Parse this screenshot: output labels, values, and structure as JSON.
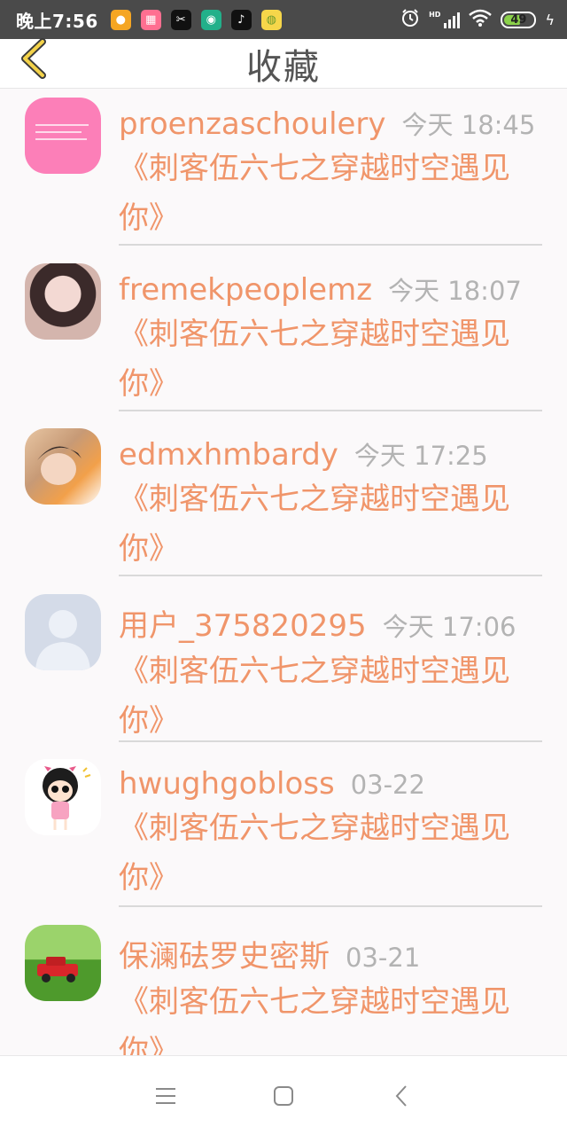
{
  "status_bar": {
    "time": "晚上7:56",
    "battery": "49",
    "apps": [
      {
        "icon": "weibo-icon",
        "color": "#f5a623"
      },
      {
        "icon": "game-center-icon",
        "color": "#ff6f91"
      },
      {
        "icon": "capcut-icon",
        "color": "#111111"
      },
      {
        "icon": "podcast-icon",
        "color": "#22b08a"
      },
      {
        "icon": "tiktok-icon",
        "color": "#111111"
      },
      {
        "icon": "chat-bubble-icon",
        "color": "#f6d64a"
      }
    ]
  },
  "header": {
    "title": "收藏",
    "back_icon": "chevron-left-icon"
  },
  "items": [
    {
      "username": "proenzaschoulery",
      "time": "今天 18:45",
      "book": "《刺客伍六七之穿越时空遇见你》",
      "avatar": "pink-note-avatar"
    },
    {
      "username": "fremekpeoplemz",
      "time": "今天 18:07",
      "book": "《刺客伍六七之穿越时空遇见你》",
      "avatar": "girl-photo-avatar"
    },
    {
      "username": "edmxhmbardy",
      "time": "今天 17:25",
      "book": "《刺客伍六七之穿越时空遇见你》",
      "avatar": "girl-selfie-avatar"
    },
    {
      "username": "用户_375820295",
      "time": "今天 17:06",
      "book": "《刺客伍六七之穿越时空遇见你》",
      "avatar": "default-user-avatar"
    },
    {
      "username": "hwughgobloss",
      "time": "03-22",
      "book": "《刺客伍六七之穿越时空遇见你》",
      "avatar": "cartoon-girl-avatar"
    },
    {
      "username": "保澜砝罗史密斯",
      "time": "03-21",
      "book": "《刺客伍六七之穿越时空遇见你》",
      "avatar": "red-car-avatar"
    }
  ],
  "colors": {
    "accent": "#f0956a",
    "timestamp": "#b3b3b3",
    "status_bar_bg": "#4a4a4a"
  },
  "nav": {
    "menu_icon": "menu-icon",
    "home_icon": "square-home-icon",
    "back_icon": "triangle-back-icon"
  }
}
